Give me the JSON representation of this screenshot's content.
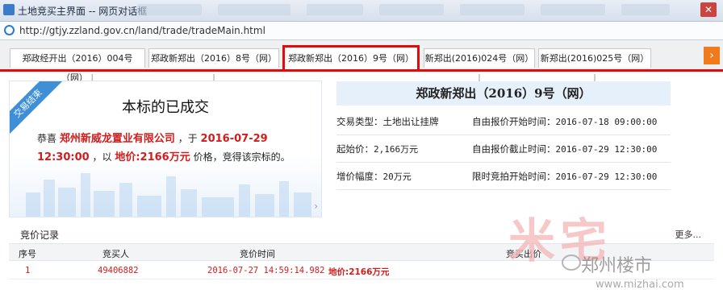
{
  "window": {
    "title": "土地竞买主界面 -- 网页对话框",
    "close_glyph": "✕"
  },
  "address": {
    "url": "http://gtjy.zzland.gov.cn/land/trade/tradeMain.html"
  },
  "tabs": [
    {
      "label": "郑政经开出（2016）004号（网）"
    },
    {
      "label": "郑政新郑出（2016）8号（网）"
    },
    {
      "label": "郑政新郑出（2016）9号（网）"
    },
    {
      "label": "新郑出(2016)024号（网）"
    },
    {
      "label": "新郑出(2016)025号（网）"
    }
  ],
  "tab_separator": "|",
  "tab_next_glyph": "›",
  "status_panel": {
    "ribbon": "交易结束",
    "title": "本标的已成交",
    "congrats": "恭喜",
    "winner": "郑州新威龙置业有限公司",
    "at": "，于",
    "time": "2016-07-29 12:30:00",
    "with": "，以",
    "price": "地价:2166万元",
    "tail": "价格，竞得该宗标的。",
    "arrow": "›"
  },
  "info": {
    "title": "郑政新郑出（2016）9号（网）",
    "rows": [
      {
        "left_label": "交易类型：",
        "left_value": "土地出让挂牌",
        "right_label": "自由报价开始时间：",
        "right_value": "2016-07-18 09:00:00"
      },
      {
        "left_label": "起始价：",
        "left_value": "2,166万元",
        "right_label": "自由报价截止时间：",
        "right_value": "2016-07-29 12:30:00"
      },
      {
        "left_label": "增价幅度：",
        "left_value": "20万元",
        "right_label": "限时竞拍开始时间：",
        "right_value": "2016-07-29 12:30:00"
      }
    ]
  },
  "records": {
    "title": "竞价记录",
    "more": "更多...",
    "columns": {
      "seq": "序号",
      "bidder": "竞买人",
      "time": "竞价时间",
      "price": "竞买出价"
    },
    "rows": [
      {
        "seq": "1",
        "bidder": "49406882",
        "time": "2016-07-27 14:59:14.982",
        "price": "地价:2166万元"
      }
    ]
  },
  "watermark": {
    "brand": "郑州楼市",
    "site": "www.mizhai.com",
    "logo_text": "米宅"
  },
  "colors": {
    "accent_red": "#e00c0c",
    "price_red": "#d41c1c",
    "ribbon_blue": "#3f8fd8",
    "tab_arrow_orange": "#f07b1c"
  }
}
